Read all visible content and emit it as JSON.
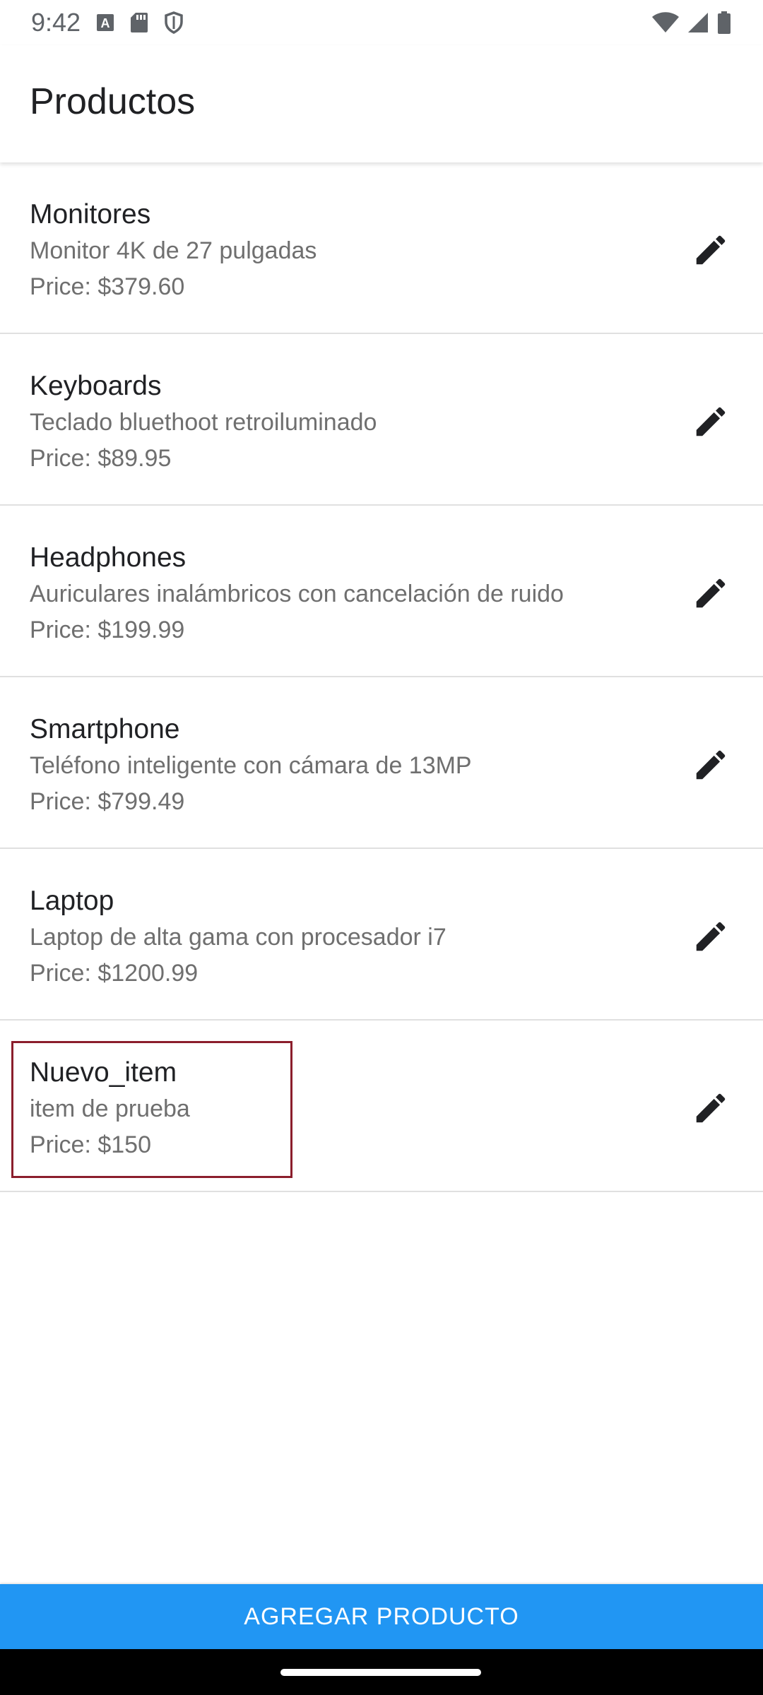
{
  "status_bar": {
    "time": "9:42",
    "left_icons": [
      "keyboard-a-icon",
      "sd-card-icon",
      "shield-icon"
    ],
    "right_icons": [
      "wifi-icon",
      "signal-icon",
      "battery-icon"
    ]
  },
  "app_bar": {
    "title": "Productos"
  },
  "products": [
    {
      "name": "Monitores",
      "description": "Monitor 4K de 27 pulgadas",
      "price_label": "Price: ",
      "price": "$379.60"
    },
    {
      "name": "Keyboards",
      "description": "Teclado bluethoot retroiluminado",
      "price_label": "Price: ",
      "price": "$89.95"
    },
    {
      "name": "Headphones",
      "description": "Auriculares inalámbricos con cancelación de ruido",
      "price_label": "Price: ",
      "price": "$199.99"
    },
    {
      "name": "Smartphone",
      "description": "Teléfono inteligente con cámara de 13MP",
      "price_label": "Price: ",
      "price": "$799.49"
    },
    {
      "name": "Laptop",
      "description": "Laptop de alta gama con procesador i7",
      "price_label": "Price: ",
      "price": "$1200.99"
    },
    {
      "name": "Nuevo_item",
      "description": "item de prueba",
      "price_label": "Price: ",
      "price": "$150"
    }
  ],
  "edit_icon": "pencil-icon",
  "add_button": {
    "label": "AGREGAR PRODUCTO"
  },
  "colors": {
    "accent": "#2196f3",
    "highlight_border": "#8b1e2c",
    "nav_bar": "#000000"
  }
}
